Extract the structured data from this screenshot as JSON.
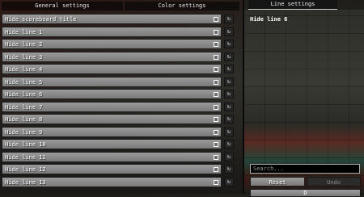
{
  "tabs": [
    {
      "label": "General settings"
    },
    {
      "label": "Color settings"
    },
    {
      "label": "Line settings"
    }
  ],
  "rows": [
    {
      "label": "Hide scoreboard title"
    },
    {
      "label": "Hide line 1"
    },
    {
      "label": "Hide line 2"
    },
    {
      "label": "Hide line 3"
    },
    {
      "label": "Hide line 4"
    },
    {
      "label": "Hide line 5"
    },
    {
      "label": "Hide line 6"
    },
    {
      "label": "Hide line 7"
    },
    {
      "label": "Hide line 8"
    },
    {
      "label": "Hide line 9"
    },
    {
      "label": "Hide line 10"
    },
    {
      "label": "Hide line 11"
    },
    {
      "label": "Hide line 12"
    },
    {
      "label": "Hide line 13"
    }
  ],
  "reset_glyph": "↻",
  "detail": {
    "title": "Hide line 6"
  },
  "search": {
    "placeholder": "Search..."
  },
  "buttons": {
    "reset": "Reset",
    "undo": "Undo",
    "partial": "D"
  }
}
